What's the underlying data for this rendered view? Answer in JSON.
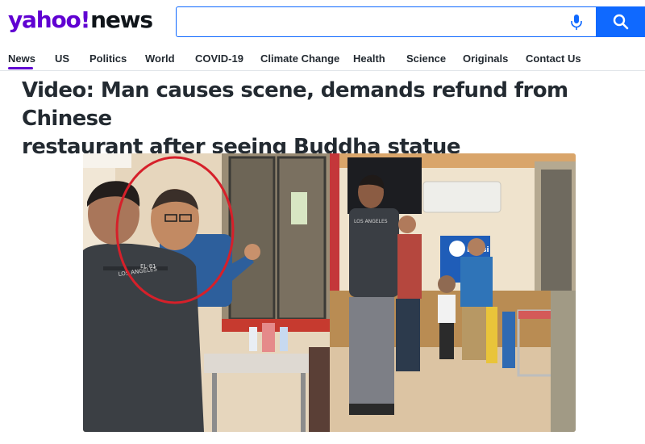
{
  "header": {
    "logo_brand": "yahoo",
    "logo_bang": "!",
    "logo_product": "news",
    "search": {
      "value": "",
      "placeholder": ""
    },
    "icons": {
      "mic": "microphone-icon",
      "search": "search-icon"
    }
  },
  "nav": {
    "items": [
      {
        "label": "News",
        "active": true
      },
      {
        "label": "US"
      },
      {
        "label": "Politics"
      },
      {
        "label": "World"
      },
      {
        "label": "COVID-19"
      },
      {
        "label": "Climate Change"
      },
      {
        "label": "Health"
      },
      {
        "label": "Science"
      },
      {
        "label": "Originals"
      },
      {
        "label": "Contact Us"
      }
    ]
  },
  "article": {
    "headline_line1": "Video: Man causes scene, demands refund from Chinese",
    "headline_line2": "restaurant after seeing Buddha statue"
  },
  "image": {
    "shirt_text_1": "EL-81",
    "shirt_text_2": "LOS ANGELES",
    "shirt_text_3": "LOS ANGELES",
    "sign_text": "Pepsi",
    "colors": {
      "highlight_circle": "#d6202a",
      "accent": "#6001d2",
      "search_blue": "#0f69ff"
    }
  }
}
